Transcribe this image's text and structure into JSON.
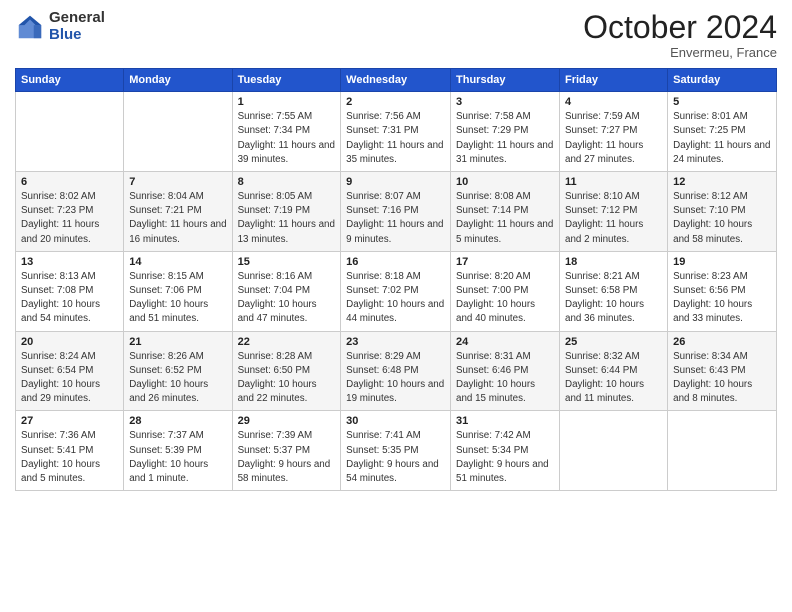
{
  "logo": {
    "general": "General",
    "blue": "Blue"
  },
  "header": {
    "month": "October 2024",
    "location": "Envermeu, France"
  },
  "weekdays": [
    "Sunday",
    "Monday",
    "Tuesday",
    "Wednesday",
    "Thursday",
    "Friday",
    "Saturday"
  ],
  "weeks": [
    [
      {
        "day": "",
        "info": ""
      },
      {
        "day": "",
        "info": ""
      },
      {
        "day": "1",
        "info": "Sunrise: 7:55 AM\nSunset: 7:34 PM\nDaylight: 11 hours and 39 minutes."
      },
      {
        "day": "2",
        "info": "Sunrise: 7:56 AM\nSunset: 7:31 PM\nDaylight: 11 hours and 35 minutes."
      },
      {
        "day": "3",
        "info": "Sunrise: 7:58 AM\nSunset: 7:29 PM\nDaylight: 11 hours and 31 minutes."
      },
      {
        "day": "4",
        "info": "Sunrise: 7:59 AM\nSunset: 7:27 PM\nDaylight: 11 hours and 27 minutes."
      },
      {
        "day": "5",
        "info": "Sunrise: 8:01 AM\nSunset: 7:25 PM\nDaylight: 11 hours and 24 minutes."
      }
    ],
    [
      {
        "day": "6",
        "info": "Sunrise: 8:02 AM\nSunset: 7:23 PM\nDaylight: 11 hours and 20 minutes."
      },
      {
        "day": "7",
        "info": "Sunrise: 8:04 AM\nSunset: 7:21 PM\nDaylight: 11 hours and 16 minutes."
      },
      {
        "day": "8",
        "info": "Sunrise: 8:05 AM\nSunset: 7:19 PM\nDaylight: 11 hours and 13 minutes."
      },
      {
        "day": "9",
        "info": "Sunrise: 8:07 AM\nSunset: 7:16 PM\nDaylight: 11 hours and 9 minutes."
      },
      {
        "day": "10",
        "info": "Sunrise: 8:08 AM\nSunset: 7:14 PM\nDaylight: 11 hours and 5 minutes."
      },
      {
        "day": "11",
        "info": "Sunrise: 8:10 AM\nSunset: 7:12 PM\nDaylight: 11 hours and 2 minutes."
      },
      {
        "day": "12",
        "info": "Sunrise: 8:12 AM\nSunset: 7:10 PM\nDaylight: 10 hours and 58 minutes."
      }
    ],
    [
      {
        "day": "13",
        "info": "Sunrise: 8:13 AM\nSunset: 7:08 PM\nDaylight: 10 hours and 54 minutes."
      },
      {
        "day": "14",
        "info": "Sunrise: 8:15 AM\nSunset: 7:06 PM\nDaylight: 10 hours and 51 minutes."
      },
      {
        "day": "15",
        "info": "Sunrise: 8:16 AM\nSunset: 7:04 PM\nDaylight: 10 hours and 47 minutes."
      },
      {
        "day": "16",
        "info": "Sunrise: 8:18 AM\nSunset: 7:02 PM\nDaylight: 10 hours and 44 minutes."
      },
      {
        "day": "17",
        "info": "Sunrise: 8:20 AM\nSunset: 7:00 PM\nDaylight: 10 hours and 40 minutes."
      },
      {
        "day": "18",
        "info": "Sunrise: 8:21 AM\nSunset: 6:58 PM\nDaylight: 10 hours and 36 minutes."
      },
      {
        "day": "19",
        "info": "Sunrise: 8:23 AM\nSunset: 6:56 PM\nDaylight: 10 hours and 33 minutes."
      }
    ],
    [
      {
        "day": "20",
        "info": "Sunrise: 8:24 AM\nSunset: 6:54 PM\nDaylight: 10 hours and 29 minutes."
      },
      {
        "day": "21",
        "info": "Sunrise: 8:26 AM\nSunset: 6:52 PM\nDaylight: 10 hours and 26 minutes."
      },
      {
        "day": "22",
        "info": "Sunrise: 8:28 AM\nSunset: 6:50 PM\nDaylight: 10 hours and 22 minutes."
      },
      {
        "day": "23",
        "info": "Sunrise: 8:29 AM\nSunset: 6:48 PM\nDaylight: 10 hours and 19 minutes."
      },
      {
        "day": "24",
        "info": "Sunrise: 8:31 AM\nSunset: 6:46 PM\nDaylight: 10 hours and 15 minutes."
      },
      {
        "day": "25",
        "info": "Sunrise: 8:32 AM\nSunset: 6:44 PM\nDaylight: 10 hours and 11 minutes."
      },
      {
        "day": "26",
        "info": "Sunrise: 8:34 AM\nSunset: 6:43 PM\nDaylight: 10 hours and 8 minutes."
      }
    ],
    [
      {
        "day": "27",
        "info": "Sunrise: 7:36 AM\nSunset: 5:41 PM\nDaylight: 10 hours and 5 minutes."
      },
      {
        "day": "28",
        "info": "Sunrise: 7:37 AM\nSunset: 5:39 PM\nDaylight: 10 hours and 1 minute."
      },
      {
        "day": "29",
        "info": "Sunrise: 7:39 AM\nSunset: 5:37 PM\nDaylight: 9 hours and 58 minutes."
      },
      {
        "day": "30",
        "info": "Sunrise: 7:41 AM\nSunset: 5:35 PM\nDaylight: 9 hours and 54 minutes."
      },
      {
        "day": "31",
        "info": "Sunrise: 7:42 AM\nSunset: 5:34 PM\nDaylight: 9 hours and 51 minutes."
      },
      {
        "day": "",
        "info": ""
      },
      {
        "day": "",
        "info": ""
      }
    ]
  ]
}
